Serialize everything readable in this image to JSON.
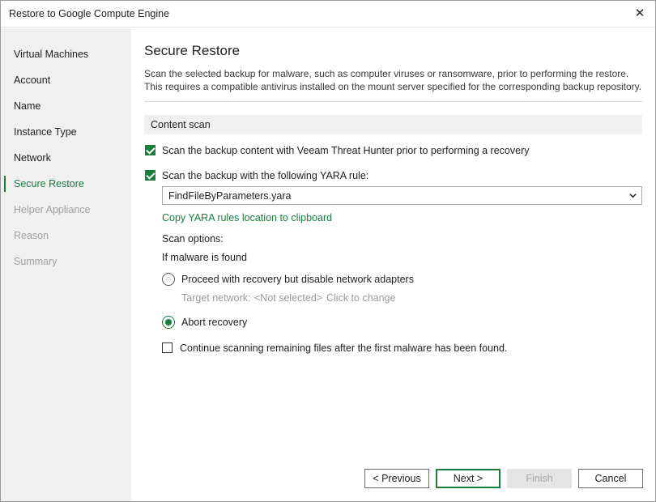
{
  "window": {
    "title": "Restore to Google Compute Engine"
  },
  "sidebar": {
    "items": [
      {
        "label": "Virtual Machines",
        "state": "normal"
      },
      {
        "label": "Account",
        "state": "normal"
      },
      {
        "label": "Name",
        "state": "normal"
      },
      {
        "label": "Instance Type",
        "state": "normal"
      },
      {
        "label": "Network",
        "state": "normal"
      },
      {
        "label": "Secure Restore",
        "state": "active"
      },
      {
        "label": "Helper Appliance",
        "state": "disabled"
      },
      {
        "label": "Reason",
        "state": "disabled"
      },
      {
        "label": "Summary",
        "state": "disabled"
      }
    ]
  },
  "main": {
    "heading": "Secure Restore",
    "description": "Scan the selected backup for malware, such as computer viruses or ransomware, prior to performing the restore. This requires a compatible antivirus installed on the mount server specified for the corresponding backup repository.",
    "section_title": "Content scan",
    "scan_threat_hunter": {
      "label": "Scan the backup content with Veeam Threat Hunter prior to performing a recovery",
      "checked": true
    },
    "scan_yara": {
      "label": "Scan the backup with the following YARA rule:",
      "checked": true
    },
    "yara_rule": {
      "value": "FindFileByParameters.yara"
    },
    "copy_link": "Copy YARA rules location to clipboard",
    "scan_options_label": "Scan options:",
    "malware_found_label": "If malware is found",
    "proceed_option": {
      "label": "Proceed with recovery but disable network adapters",
      "checked": false
    },
    "target_network": {
      "label": "Target network:",
      "value": "<Not selected>",
      "action": "Click to change"
    },
    "abort_option": {
      "label": "Abort recovery",
      "checked": true
    },
    "continue_scanning": {
      "label": "Continue scanning remaining files after the first malware has been found.",
      "checked": false
    }
  },
  "buttons": {
    "previous": "< Previous",
    "next": "Next >",
    "finish": "Finish",
    "cancel": "Cancel"
  },
  "colors": {
    "accent": "#1a7d3c",
    "sidebar_bg": "#f0f0f0",
    "disabled_text": "#a0a0a0"
  }
}
